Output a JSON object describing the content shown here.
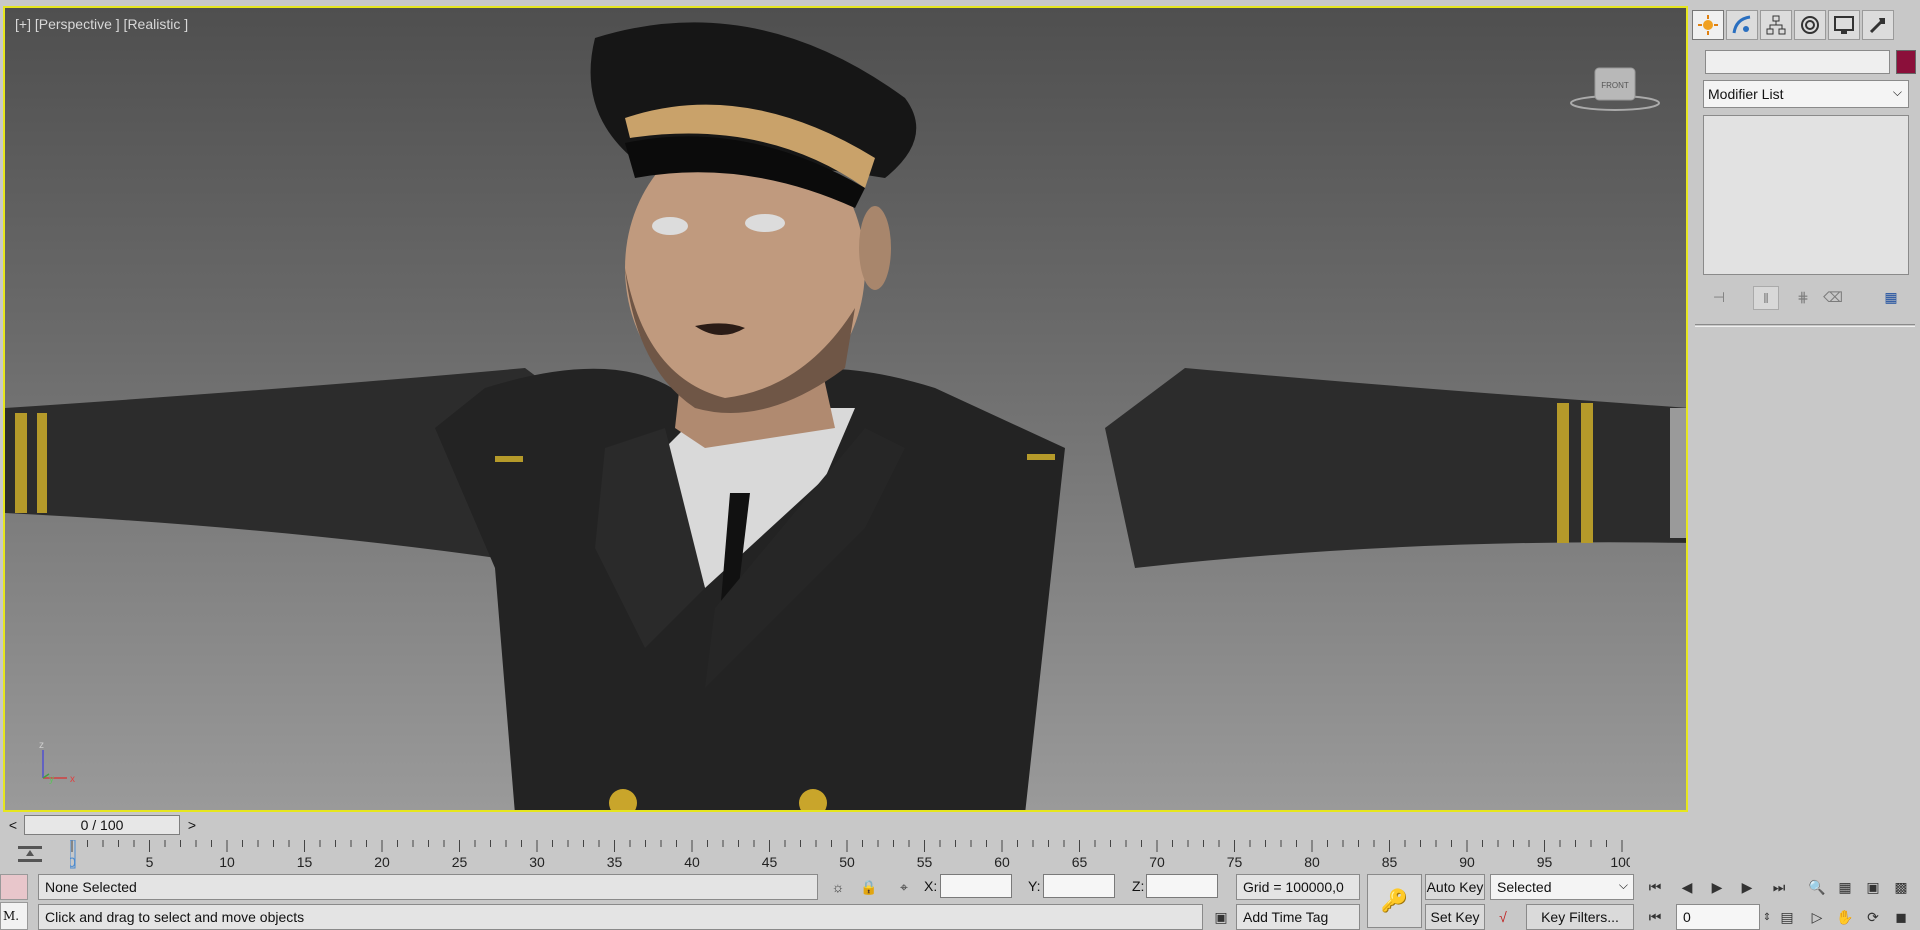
{
  "viewport": {
    "label": "[+] [Perspective ] [Realistic ]",
    "viewcube_label": "FRONT",
    "axis_labels": {
      "z": "z",
      "y": "y",
      "x": "x"
    }
  },
  "command_panel": {
    "tabs": [
      "create-icon",
      "modify-icon",
      "hierarchy-icon",
      "motion-icon",
      "display-icon",
      "utilities-icon"
    ],
    "object_name": "",
    "object_color": "#8b0f3a",
    "modifier_list": "Modifier List"
  },
  "time_slider": {
    "prev": "<",
    "position": "0 / 100",
    "next": ">"
  },
  "trackbar": {
    "ticks": [
      "0",
      "5",
      "10",
      "15",
      "20",
      "25",
      "30",
      "35",
      "40",
      "45",
      "50",
      "55",
      "60",
      "65",
      "70",
      "75",
      "80",
      "85",
      "90",
      "95",
      "100"
    ]
  },
  "status": {
    "selection": "None Selected",
    "prompt": "Click and drag to select and move objects",
    "x_label": "X:",
    "y_label": "Y:",
    "z_label": "Z:",
    "x_value": "",
    "y_value": "",
    "z_value": "",
    "grid": "Grid = 100000,0",
    "add_time_tag": "Add Time Tag",
    "listener": "M."
  },
  "animation": {
    "auto_key": "Auto Key",
    "set_key": "Set Key",
    "key_mode": "Selected",
    "key_filters": "Key Filters...",
    "current_frame": "0"
  },
  "colors": {
    "viewport_border": "#e6e61e",
    "active_frame": "#4a8ad0"
  }
}
